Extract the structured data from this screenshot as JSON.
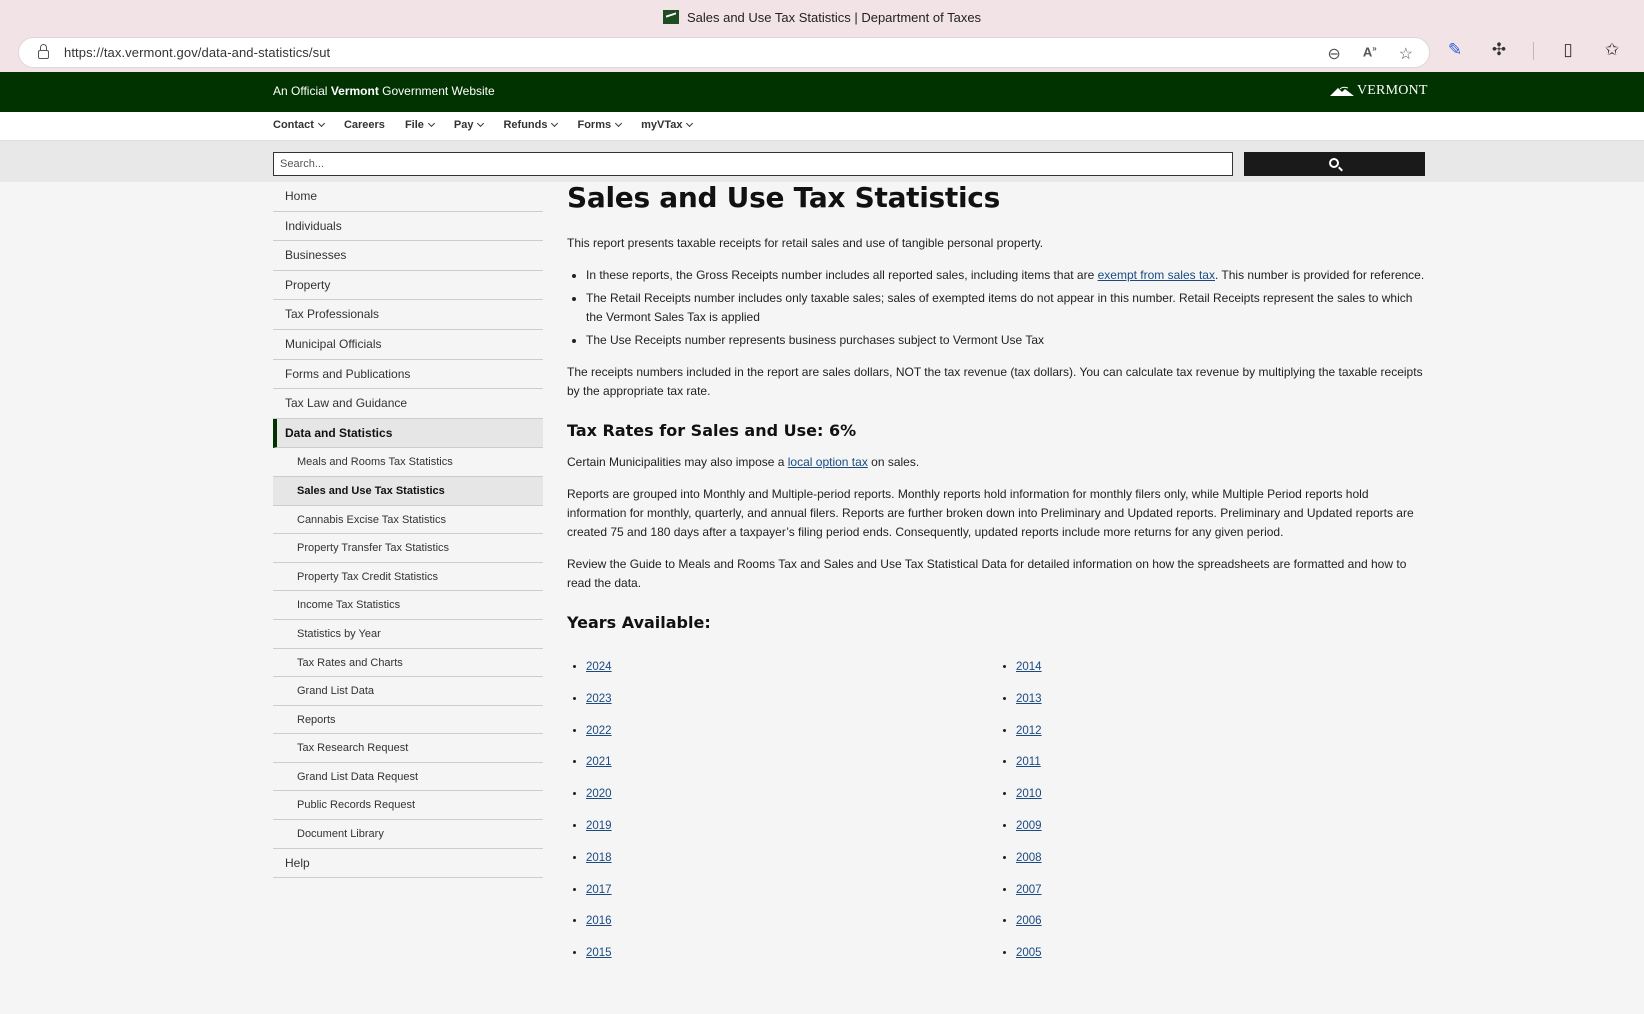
{
  "browser": {
    "tab_title": "Sales and Use Tax Statistics | Department of Taxes",
    "url": "https://tax.vermont.gov/data-and-statistics/sut"
  },
  "site": {
    "gov_banner_prefix": "An Official",
    "gov_banner_bold": "Vermont",
    "gov_banner_suffix": "Government Website",
    "logo_text": "VERMONT",
    "search_placeholder": "Search..."
  },
  "topnav": [
    {
      "label": "Contact",
      "dropdown": true
    },
    {
      "label": "Careers",
      "dropdown": false
    },
    {
      "label": "File",
      "dropdown": true
    },
    {
      "label": "Pay",
      "dropdown": true
    },
    {
      "label": "Refunds",
      "dropdown": true
    },
    {
      "label": "Forms",
      "dropdown": true
    },
    {
      "label": "myVTax",
      "dropdown": true
    }
  ],
  "sidebar": {
    "top_items": [
      "Home",
      "Individuals",
      "Businesses",
      "Property",
      "Tax Professionals",
      "Municipal Officials",
      "Forms and Publications",
      "Tax Law and Guidance"
    ],
    "active_item": "Data and Statistics",
    "sub_items": [
      "Meals and Rooms Tax Statistics",
      "Sales and Use Tax Statistics",
      "Cannabis Excise Tax Statistics",
      "Property Transfer Tax Statistics",
      "Property Tax Credit Statistics",
      "Income Tax Statistics",
      "Statistics by Year",
      "Tax Rates and Charts",
      "Grand List Data",
      "Reports",
      "Tax Research Request",
      "Grand List Data Request",
      "Public Records Request",
      "Document Library"
    ],
    "current_sub": "Sales and Use Tax Statistics",
    "bottom_item": "Help"
  },
  "main": {
    "title": "Sales and Use Tax Statistics",
    "intro": "This report presents taxable receipts for retail sales and use of tangible personal property.",
    "bullet1_before": "In these reports, the Gross Receipts number includes all reported sales, including items that are ",
    "bullet1_link": "exempt from sales tax",
    "bullet1_after": ". This number is provided for reference.",
    "bullet2": "The Retail Receipts number includes only taxable sales; sales of exempted items do not appear in this number. Retail Receipts represent the sales to which the Vermont Sales Tax is applied",
    "bullet3": "The Use Receipts number represents business purchases subject to Vermont Use Tax",
    "receipts_note": "The receipts numbers included in the report are sales dollars, NOT the tax revenue (tax dollars). You can calculate tax revenue by multiplying the taxable receipts by the appropriate tax rate.",
    "rates_heading": "Tax Rates for Sales and Use: 6%",
    "local_before": "Certain Municipalities may also impose a ",
    "local_link": "local option tax",
    "local_after": " on sales.",
    "reports_para": "Reports are grouped into Monthly and Multiple-period reports. Monthly reports hold information for monthly filers only, while Multiple Period reports hold information for monthly, quarterly, and annual filers. Reports are further broken down into Preliminary and Updated reports.  Preliminary and Updated reports are created 75 and 180 days after a taxpayer’s filing period ends. Consequently, updated reports include more returns for any given period.",
    "guide_para": "Review the Guide to Meals and Rooms Tax and Sales and Use Tax Statistical Data for detailed information on how the spreadsheets are formatted and how to read the data.",
    "years_heading": "Years Available:",
    "years_left": [
      "2024",
      "2023",
      "2022",
      "2021",
      "2020",
      "2019",
      "2018",
      "2017",
      "2016",
      "2015"
    ],
    "years_right": [
      "2014",
      "2013",
      "2012",
      "2011",
      "2010",
      "2009",
      "2008",
      "2007",
      "2006",
      "2005"
    ]
  },
  "icons": {
    "zoom": "zoom-out-icon",
    "read_aloud": "read-aloud-icon",
    "favorite": "star-icon",
    "accent": "#003300",
    "link": "#1a4a80"
  }
}
